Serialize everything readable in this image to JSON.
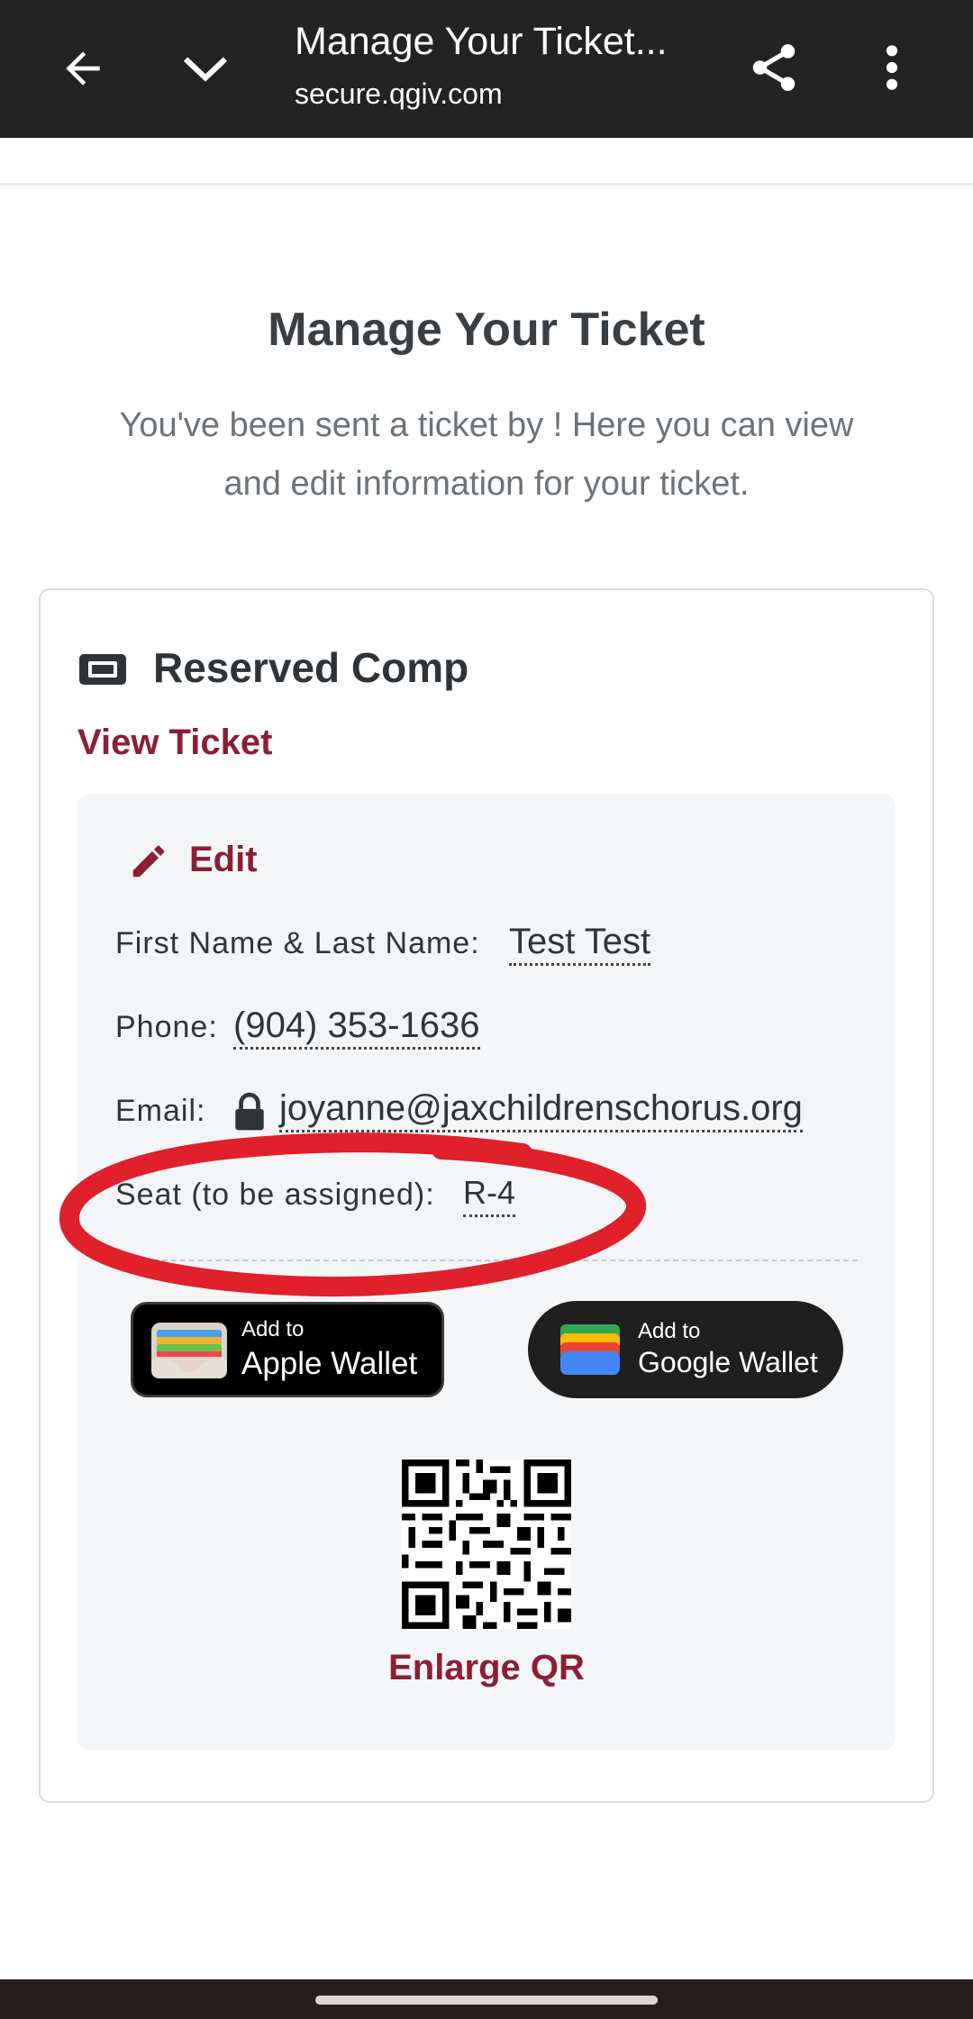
{
  "browser": {
    "title": "Manage Your Ticket...",
    "url": "secure.qgiv.com"
  },
  "page": {
    "title": "Manage Your Ticket",
    "description": "You've been sent a ticket by ! Here you can view and edit information for your ticket."
  },
  "ticket": {
    "name": "Reserved Comp",
    "view_link": "View Ticket",
    "edit_label": "Edit",
    "fields": [
      {
        "label": "First Name & Last Name:",
        "value": "Test Test"
      },
      {
        "label": "Phone:",
        "value": "(904) 353-1636"
      },
      {
        "label": "Email:",
        "value": "joyanne@jaxchildrenschorus.org"
      },
      {
        "label": "Seat (to be assigned):",
        "value": "R-4"
      }
    ],
    "apple_wallet": {
      "small": "Add to",
      "big": "Apple Wallet"
    },
    "google_wallet": {
      "small": "Add to",
      "big": "Google Wallet"
    },
    "enlarge_qr": "Enlarge QR"
  },
  "colors": {
    "accent": "#8a1f35",
    "annotation": "#e0202a",
    "topbar": "#232323"
  },
  "icons": [
    "back-arrow-icon",
    "chevron-down-icon",
    "share-icon",
    "more-vert-icon",
    "ticket-icon",
    "pencil-icon",
    "lock-icon",
    "wallet-icon",
    "qr-code"
  ]
}
